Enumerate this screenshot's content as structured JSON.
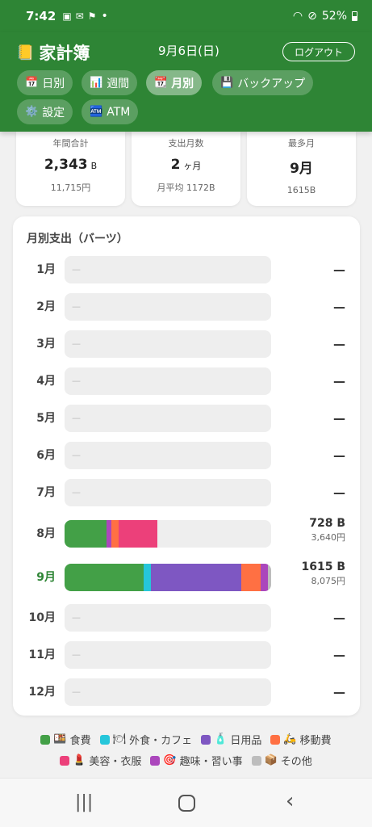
{
  "status": {
    "time": "7:42",
    "battery": "52%",
    "icons": [
      "gallery-icon",
      "mail-icon",
      "flag-icon"
    ]
  },
  "header": {
    "app_title": "家計簿",
    "date": "9月6日(日)",
    "logout_label": "ログアウト",
    "tabs": [
      {
        "icon": "📅",
        "label": "日別"
      },
      {
        "icon": "📊",
        "label": "週間"
      },
      {
        "icon": "📆",
        "label": "月別"
      },
      {
        "icon": "💾",
        "label": "バックアップ"
      },
      {
        "icon": "⚙️",
        "label": "設定"
      },
      {
        "icon": "🏧",
        "label": "ATM"
      }
    ],
    "active_tab": "月別"
  },
  "summary": [
    {
      "label": "年間合計",
      "value": "2,343",
      "unit": "B",
      "sub": "11,715円"
    },
    {
      "label": "支出月数",
      "value": "2",
      "unit": "ヶ月",
      "sub": "月平均 1172B"
    },
    {
      "label": "最多月",
      "value": "9月",
      "unit": "",
      "sub": "1615B"
    }
  ],
  "monthly": {
    "title": "月別支出（バーツ）",
    "empty_placeholder": "—",
    "max_value": 1615,
    "months": [
      {
        "label": "1月",
        "value_text": "—",
        "yen": "",
        "segments": []
      },
      {
        "label": "2月",
        "value_text": "—",
        "yen": "",
        "segments": []
      },
      {
        "label": "3月",
        "value_text": "—",
        "yen": "",
        "segments": []
      },
      {
        "label": "4月",
        "value_text": "—",
        "yen": "",
        "segments": []
      },
      {
        "label": "5月",
        "value_text": "—",
        "yen": "",
        "segments": []
      },
      {
        "label": "6月",
        "value_text": "—",
        "yen": "",
        "segments": []
      },
      {
        "label": "7月",
        "value_text": "—",
        "yen": "",
        "segments": []
      },
      {
        "label": "8月",
        "value_text": "728 B",
        "yen": "3,640円",
        "segments": [
          {
            "category": "食費",
            "value": 330
          },
          {
            "category": "趣味・習い事",
            "value": 35
          },
          {
            "category": "移動費",
            "value": 55
          },
          {
            "category": "美容・衣服",
            "value": 308
          }
        ]
      },
      {
        "label": "9月",
        "value_text": "1615 B",
        "yen": "8,075円",
        "current": true,
        "segments": [
          {
            "category": "食費",
            "value": 620
          },
          {
            "category": "外食・カフェ",
            "value": 55
          },
          {
            "category": "日用品",
            "value": 705
          },
          {
            "category": "移動費",
            "value": 155
          },
          {
            "category": "趣味・習い事",
            "value": 55
          },
          {
            "category": "その他",
            "value": 25
          }
        ]
      },
      {
        "label": "10月",
        "value_text": "—",
        "yen": "",
        "segments": []
      },
      {
        "label": "11月",
        "value_text": "—",
        "yen": "",
        "segments": []
      },
      {
        "label": "12月",
        "value_text": "—",
        "yen": "",
        "segments": []
      }
    ]
  },
  "legend": [
    {
      "icon": "🍱",
      "label": "食費",
      "color": "#43a047"
    },
    {
      "icon": "🍽",
      "label": "外食・カフェ",
      "color": "#26c6da"
    },
    {
      "icon": "🧴",
      "label": "日用品",
      "color": "#7e57c2"
    },
    {
      "icon": "🛵",
      "label": "移動費",
      "color": "#ff7043"
    },
    {
      "icon": "💄",
      "label": "美容・衣服",
      "color": "#ec407a"
    },
    {
      "icon": "🎯",
      "label": "趣味・習い事",
      "color": "#ab47bc"
    },
    {
      "icon": "📦",
      "label": "その他",
      "color": "#bdbdbd"
    }
  ],
  "nav": {
    "recents": "recent-apps",
    "home": "home",
    "back": "back"
  }
}
